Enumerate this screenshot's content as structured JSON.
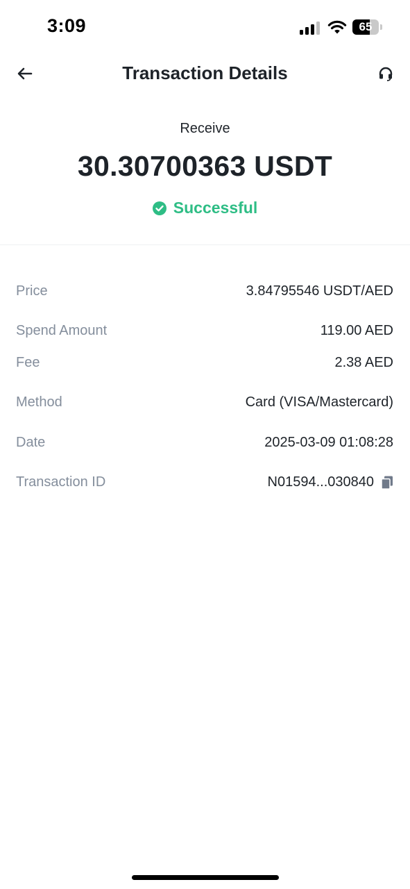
{
  "status_bar": {
    "time": "3:09",
    "battery_level": "65",
    "battery_percent": 65
  },
  "header": {
    "title": "Transaction Details",
    "back_icon": "arrow-left-icon",
    "support_icon": "headset-icon"
  },
  "summary": {
    "type": "Receive",
    "amount": "30.30700363 USDT",
    "status": "Successful",
    "status_color": "#2ebd85",
    "status_icon": "check-circle-icon"
  },
  "details": [
    {
      "label": "Price",
      "value": "3.84795546 USDT/AED"
    },
    {
      "label": "Spend Amount",
      "value": "119.00 AED"
    },
    {
      "label": "Fee",
      "value": "2.38 AED"
    },
    {
      "label": "Method",
      "value": "Card (VISA/Mastercard)"
    },
    {
      "label": "Date",
      "value": "2025-03-09 01:08:28"
    },
    {
      "label": "Transaction ID",
      "value": "N01594...030840",
      "copy_icon": "copy-icon"
    }
  ]
}
